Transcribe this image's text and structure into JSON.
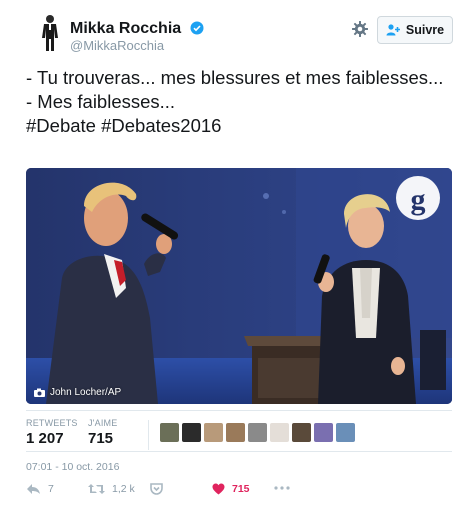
{
  "user": {
    "name": "Mikka Rocchia",
    "handle": "@MikkaRocchia",
    "follow_label": "Suivre"
  },
  "tweet": {
    "lines": [
      "- Tu trouveras... mes blessures et mes faiblesses...",
      "- Mes faiblesses..."
    ],
    "hashtags": [
      "#Debate",
      "#Debates2016"
    ]
  },
  "media": {
    "credit": "John Locher/AP",
    "watermark": "g"
  },
  "stats": {
    "retweets_label": "RETWEETS",
    "retweets_value": "1 207",
    "likes_label": "J'AIME",
    "likes_value": "715",
    "liker_avatar_colors": [
      "#6b6f58",
      "#2b2b2b",
      "#b89a7a",
      "#9a7a5a",
      "#8a8a8a",
      "#e4ded8",
      "#5a4a3a",
      "#7a6fb0",
      "#6a8fb8"
    ]
  },
  "timestamp": "07:01 - 10 oct. 2016",
  "actions": {
    "replies": "7",
    "retweets": "1,2 k",
    "likes": "715"
  },
  "colors": {
    "like_accent": "#e0245e",
    "verified": "#1da1f2",
    "muted": "#8899a6"
  }
}
